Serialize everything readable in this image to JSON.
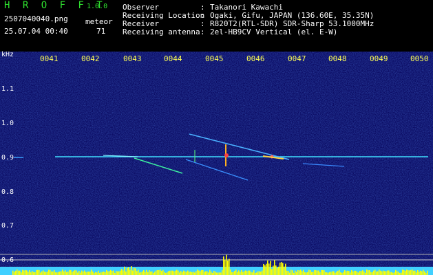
{
  "app": {
    "brand": "H R O F F T",
    "version": "1.0.0"
  },
  "file": {
    "name": "2507040040.png",
    "datetime": "25.07.04 00:40"
  },
  "meteor": {
    "label": "meteor",
    "count": "71"
  },
  "info": [
    {
      "key": "Observer",
      "value": "Takanori Kawachi"
    },
    {
      "key": "Receiving Location",
      "value": "Ogaki, Gifu, JAPAN (136.60E, 35.35N)"
    },
    {
      "key": "Receiver",
      "value": "R820T2(RTL-SDR) SDR-Sharp 53.1000MHz"
    },
    {
      "key": "Receiving antenna",
      "value": "2el-HB9CV Vertical (el. E-W)"
    }
  ],
  "axis": {
    "y_unit": "kHz",
    "x_ticks": [
      "0041",
      "0042",
      "0043",
      "0044",
      "0045",
      "0046",
      "0047",
      "0048",
      "0049",
      "0050"
    ],
    "y_ticks": [
      "1.1",
      "1.0",
      "0.9",
      "0.8",
      "0.7",
      "0.6"
    ]
  },
  "colors": {
    "background": "#0a0a6e",
    "carrier": "#40e0ff",
    "header_text": "#ffffff",
    "tick_text": "#ffff55",
    "power_bar": "#ffff00"
  }
}
